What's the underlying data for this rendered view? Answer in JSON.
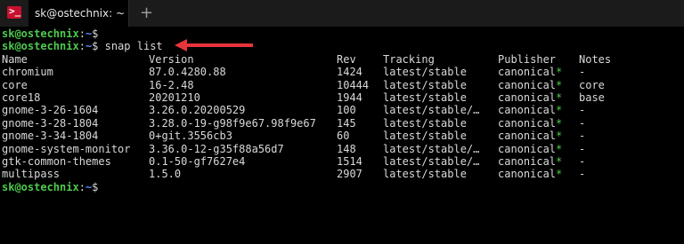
{
  "window": {
    "tab_title": "sk@ostechnix: ~",
    "app_icon_glyph": ">_",
    "new_tab_glyph": "+",
    "app_icon_color": "#c8102e"
  },
  "terminal": {
    "user": "sk@ostechnix",
    "sep": ":",
    "path": "~",
    "prompt_end": "$ ",
    "command": "snap list",
    "headers": [
      "Name",
      "Version",
      "Rev",
      "Tracking",
      "Publisher",
      "Notes"
    ],
    "rows": [
      {
        "name": "chromium",
        "version": "87.0.4280.88",
        "rev": "1424",
        "tracking": "latest/stable",
        "publisher": "canonical",
        "mark": "*",
        "notes": "-"
      },
      {
        "name": "core",
        "version": "16-2.48",
        "rev": "10444",
        "tracking": "latest/stable",
        "publisher": "canonical",
        "mark": "*",
        "notes": "core"
      },
      {
        "name": "core18",
        "version": "20201210",
        "rev": "1944",
        "tracking": "latest/stable",
        "publisher": "canonical",
        "mark": "*",
        "notes": "base"
      },
      {
        "name": "gnome-3-26-1604",
        "version": "3.26.0.20200529",
        "rev": "100",
        "tracking": "latest/stable/…",
        "publisher": "canonical",
        "mark": "*",
        "notes": "-"
      },
      {
        "name": "gnome-3-28-1804",
        "version": "3.28.0-19-g98f9e67.98f9e67",
        "rev": "145",
        "tracking": "latest/stable",
        "publisher": "canonical",
        "mark": "*",
        "notes": "-"
      },
      {
        "name": "gnome-3-34-1804",
        "version": "0+git.3556cb3",
        "rev": "60",
        "tracking": "latest/stable",
        "publisher": "canonical",
        "mark": "*",
        "notes": "-"
      },
      {
        "name": "gnome-system-monitor",
        "version": "3.36.0-12-g35f88a56d7",
        "rev": "148",
        "tracking": "latest/stable/…",
        "publisher": "canonical",
        "mark": "*",
        "notes": "-"
      },
      {
        "name": "gtk-common-themes",
        "version": "0.1-50-gf7627e4",
        "rev": "1514",
        "tracking": "latest/stable/…",
        "publisher": "canonical",
        "mark": "*",
        "notes": "-"
      },
      {
        "name": "multipass",
        "version": "1.5.0",
        "rev": "2907",
        "tracking": "latest/stable",
        "publisher": "canonical",
        "mark": "*",
        "notes": "-"
      }
    ]
  },
  "colors": {
    "user": "#4ec94e",
    "path": "#5a8cff",
    "arrow": "#e8343c"
  },
  "icons": [
    "terminal-app-icon",
    "new-tab-icon",
    "annotation-arrow-icon"
  ]
}
